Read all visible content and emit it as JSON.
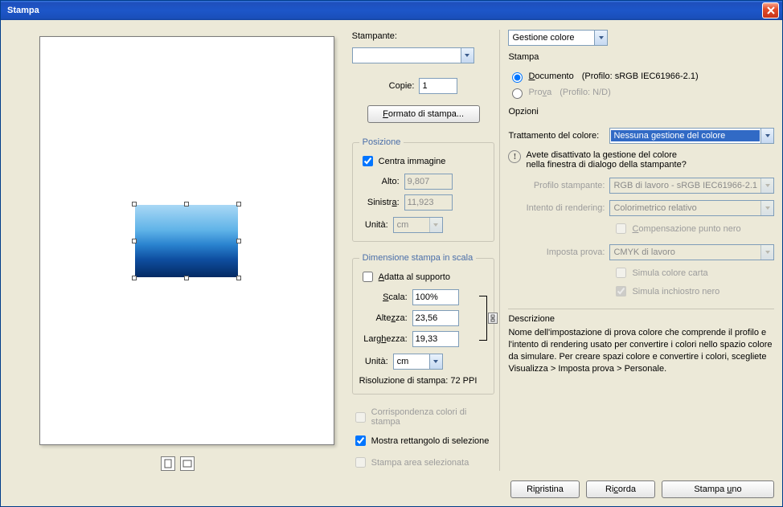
{
  "window": {
    "title": "Stampa"
  },
  "preview": {
    "icon1": "portrait-icon",
    "icon2": "landscape-icon"
  },
  "mid": {
    "stampante_label": "Stampante:",
    "stampante_value": "",
    "copie_label": "Copie:",
    "copie_value": "1",
    "formato_button": "Formato di stampa...",
    "posizione": {
      "legend": "Posizione",
      "centra_label": "Centra immagine",
      "centra_checked": true,
      "alto_label": "Alto:",
      "alto_value": "9,807",
      "sinistra_label": "Sinistra:",
      "sinistra_value": "11,923",
      "unita_label": "Unità:",
      "unita_value": "cm"
    },
    "dimensione": {
      "legend": "Dimensione stampa in scala",
      "adatta_label": "Adatta al supporto",
      "adatta_checked": false,
      "scala_label": "Scala:",
      "scala_value": "100%",
      "altezza_label": "Altezza:",
      "altezza_value": "23,56",
      "larghezza_label": "Larghezza:",
      "larghezza_value": "19,33",
      "unita_label": "Unità:",
      "unita_value": "cm",
      "risoluzione": "Risoluzione di stampa: 72 PPI"
    },
    "corrispondenza_label": "Corrispondenza colori di stampa",
    "mostra_label": "Mostra rettangolo di selezione",
    "mostra_checked": true,
    "stampa_area_label": "Stampa area selezionata"
  },
  "right": {
    "section_select": "Gestione colore",
    "stampa_heading": "Stampa",
    "documento_label": "Documento",
    "documento_profile": "(Profilo: sRGB IEC61966-2.1)",
    "prova_label": "Prova",
    "prova_profile": "(Profilo: N/D)",
    "opzioni_heading": "Opzioni",
    "trattamento_label": "Trattamento del colore:",
    "trattamento_value": "Nessuna gestione del colore",
    "warning_line1": "Avete disattivato la gestione del colore",
    "warning_line2": "nella finestra di dialogo della stampante?",
    "profilo_stampante_label": "Profilo stampante:",
    "profilo_stampante_value": "RGB di lavoro - sRGB IEC61966-2.1",
    "intento_label": "Intento di rendering:",
    "intento_value": "Colorimetrico relativo",
    "compensazione_label": "Compensazione punto nero",
    "imposta_prova_label": "Imposta prova:",
    "imposta_prova_value": "CMYK di lavoro",
    "simula_carta_label": "Simula colore carta",
    "simula_inchiostro_label": "Simula inchiostro nero",
    "descrizione_heading": "Descrizione",
    "descrizione_text": "Nome dell'impostazione di prova colore che comprende il profilo e l'intento di rendering usato per convertire i colori nello spazio colore da simulare. Per creare spazi colore e convertire i colori, scegliete Visualizza > Imposta prova > Personale."
  },
  "footer": {
    "ripristina": "Ripristina",
    "ricorda": "Ricorda",
    "stampa_uno": "Stampa uno"
  }
}
